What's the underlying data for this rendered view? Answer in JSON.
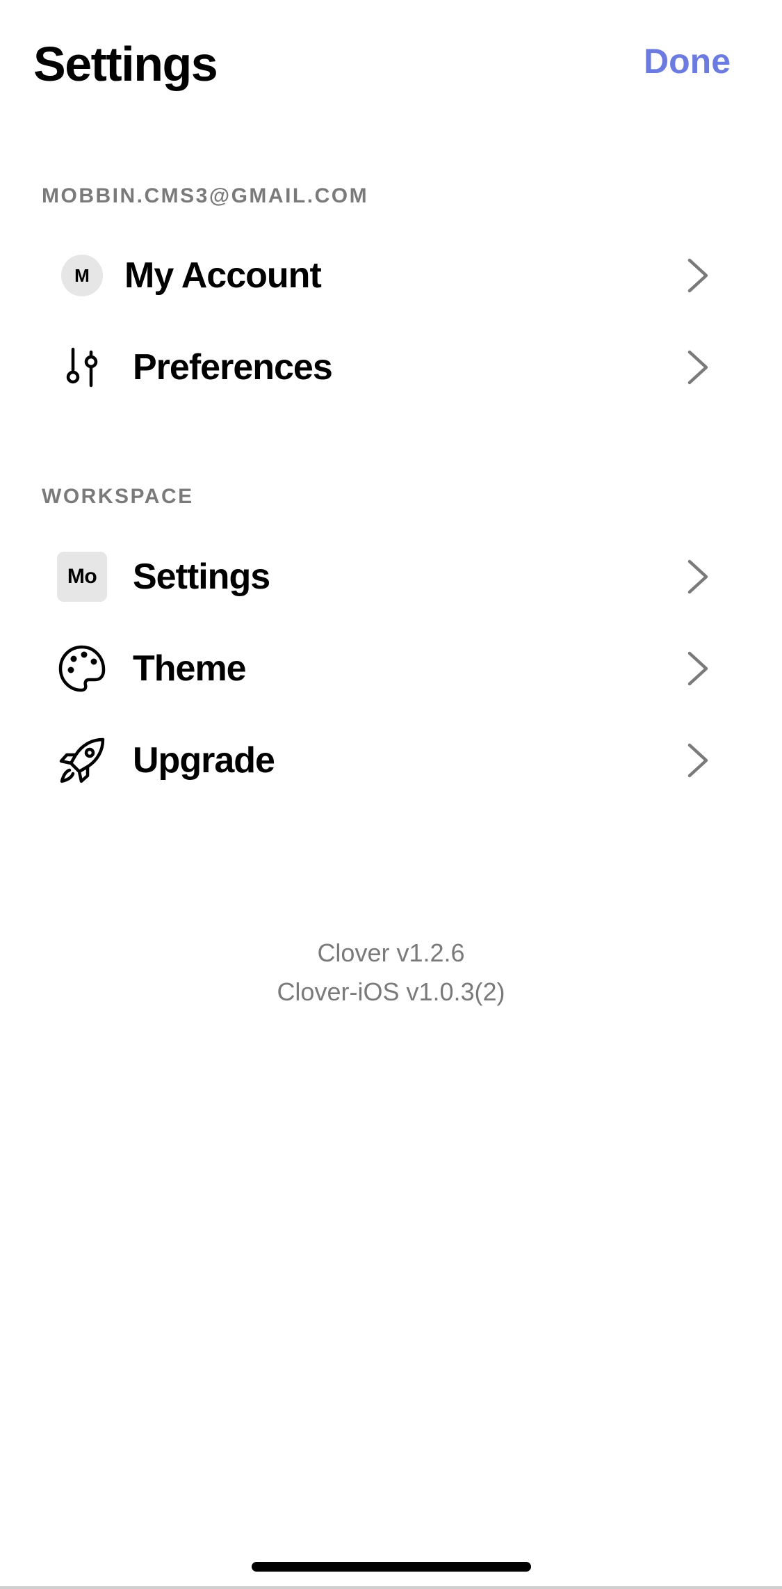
{
  "header": {
    "title": "Settings",
    "done_label": "Done"
  },
  "account_section": {
    "email": "MOBBIN.CMS3@GMAIL.COM",
    "items": [
      {
        "label": "My Account",
        "avatar_initial": "M",
        "icon": "avatar-icon"
      },
      {
        "label": "Preferences",
        "icon": "sliders-icon"
      }
    ]
  },
  "workspace_section": {
    "title": "WORKSPACE",
    "items": [
      {
        "label": "Settings",
        "badge": "Mo",
        "icon": "workspace-badge-icon"
      },
      {
        "label": "Theme",
        "icon": "palette-icon"
      },
      {
        "label": "Upgrade",
        "icon": "rocket-icon"
      }
    ]
  },
  "footer": {
    "app_version": "Clover v1.2.6",
    "ios_version": "Clover-iOS v1.0.3(2)"
  },
  "colors": {
    "accent": "#6B7BE0",
    "secondary_text": "#7a7a7a",
    "badge_bg": "#e6e6e6"
  }
}
